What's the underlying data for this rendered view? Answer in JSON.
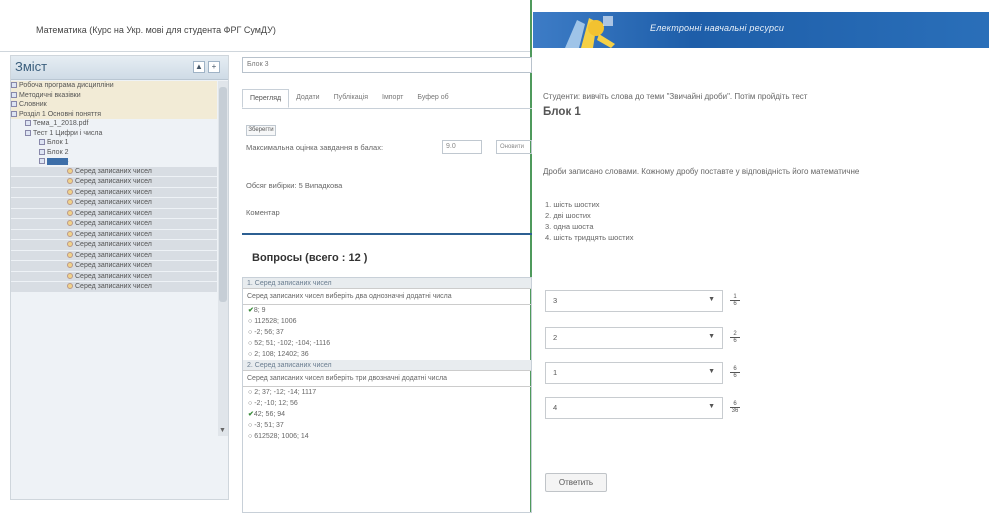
{
  "left_window": {
    "title": "Математика (Курс на Укр. мові для студента ФРГ СумДУ)",
    "tree": {
      "header": "Зміст",
      "btn_up": "▲",
      "btn_down": "+",
      "items": [
        {
          "label": "Робоча програма дисципліни",
          "style": "hl"
        },
        {
          "label": "Методичні вказівки",
          "style": "hl"
        },
        {
          "label": "Словник",
          "style": "hl"
        },
        {
          "label": "Розділ 1 Основні поняття",
          "style": "hl"
        },
        {
          "label": "Тема_1_2018.pdf",
          "style": "sub"
        },
        {
          "label": "Тест 1 Цифри і числа",
          "style": "sub"
        },
        {
          "label": "Блок 1",
          "style": "sub2"
        },
        {
          "label": "Блок 2",
          "style": "sub2"
        },
        {
          "label": "Блок 3",
          "style": "sel"
        }
      ],
      "questions": [
        "Серед записаних чисел",
        "Серед записаних чисел",
        "Серед записаних чисел",
        "Серед записаних чисел",
        "Серед записаних чисел",
        "Серед записаних чисел",
        "Серед записаних чисел",
        "Серед записаних чисел",
        "Серед записаних чисел",
        "Серед записаних чисел",
        "Серед записаних чисел",
        "Серед записаних чисел"
      ]
    },
    "editor": {
      "block_name": "Блок 3",
      "tabs": [
        "Перегляд",
        "Додати",
        "Публікація",
        "Імпорт",
        "Буфер об"
      ],
      "small_button": "Зберегти",
      "max_score_label": "Максимальна оцінка завдання в балах:",
      "max_score_value": "9.0",
      "max_score_btn": "Оновити",
      "sample_label": "Обсяг вибірки: 5 Випадкова",
      "comment_label": "Коментар",
      "questions_heading": "Вопросы (всего : 12 )",
      "q1_title": "1. Серед записаних чисел",
      "q1_text": "Серед записаних чисел виберіть два однозначні додатні числа",
      "q1_answers": [
        {
          "mark": "✔",
          "text": "8; 9"
        },
        {
          "mark": "",
          "text": "112528; 1006"
        },
        {
          "mark": "",
          "text": "-2; 56; 37"
        },
        {
          "mark": "",
          "text": "52; 51; -102; -104; -1116"
        },
        {
          "mark": "",
          "text": "2; 108; 12402; 36"
        }
      ],
      "q2_title": "2. Серед записаних чисел",
      "q2_text": "Серед записаних чисел виберіть три двозначні додатні числа",
      "q2_answers": [
        {
          "mark": "",
          "text": "2; 37; -12; -14; 1117"
        },
        {
          "mark": "",
          "text": "-2; -10; 12; 56"
        },
        {
          "mark": "✔",
          "text": "42; 56; 94"
        },
        {
          "mark": "",
          "text": "-3; 51; 37"
        },
        {
          "mark": "",
          "text": "612528; 1006; 14"
        }
      ]
    }
  },
  "right_window": {
    "banner_title": "Електронні навчальні ресурси",
    "intro": "Студенти: вивчіть слова до теми \"Звичайні дроби\". Потім пройдіть тест",
    "block_title": "Блок 1",
    "instruction": "Дроби записано словами. Кожному  дробу поставте у відповідність його математичне",
    "list": [
      "шість шостих",
      "дві шостих",
      "одна шоста",
      "шість тридцять шостих"
    ],
    "selects": [
      {
        "value": "3",
        "num": "1",
        "den": "6"
      },
      {
        "value": "2",
        "num": "2",
        "den": "6"
      },
      {
        "value": "1",
        "num": "6",
        "den": "6"
      },
      {
        "value": "4",
        "num": "6",
        "den": "36"
      }
    ],
    "submit_label": "Ответить"
  }
}
